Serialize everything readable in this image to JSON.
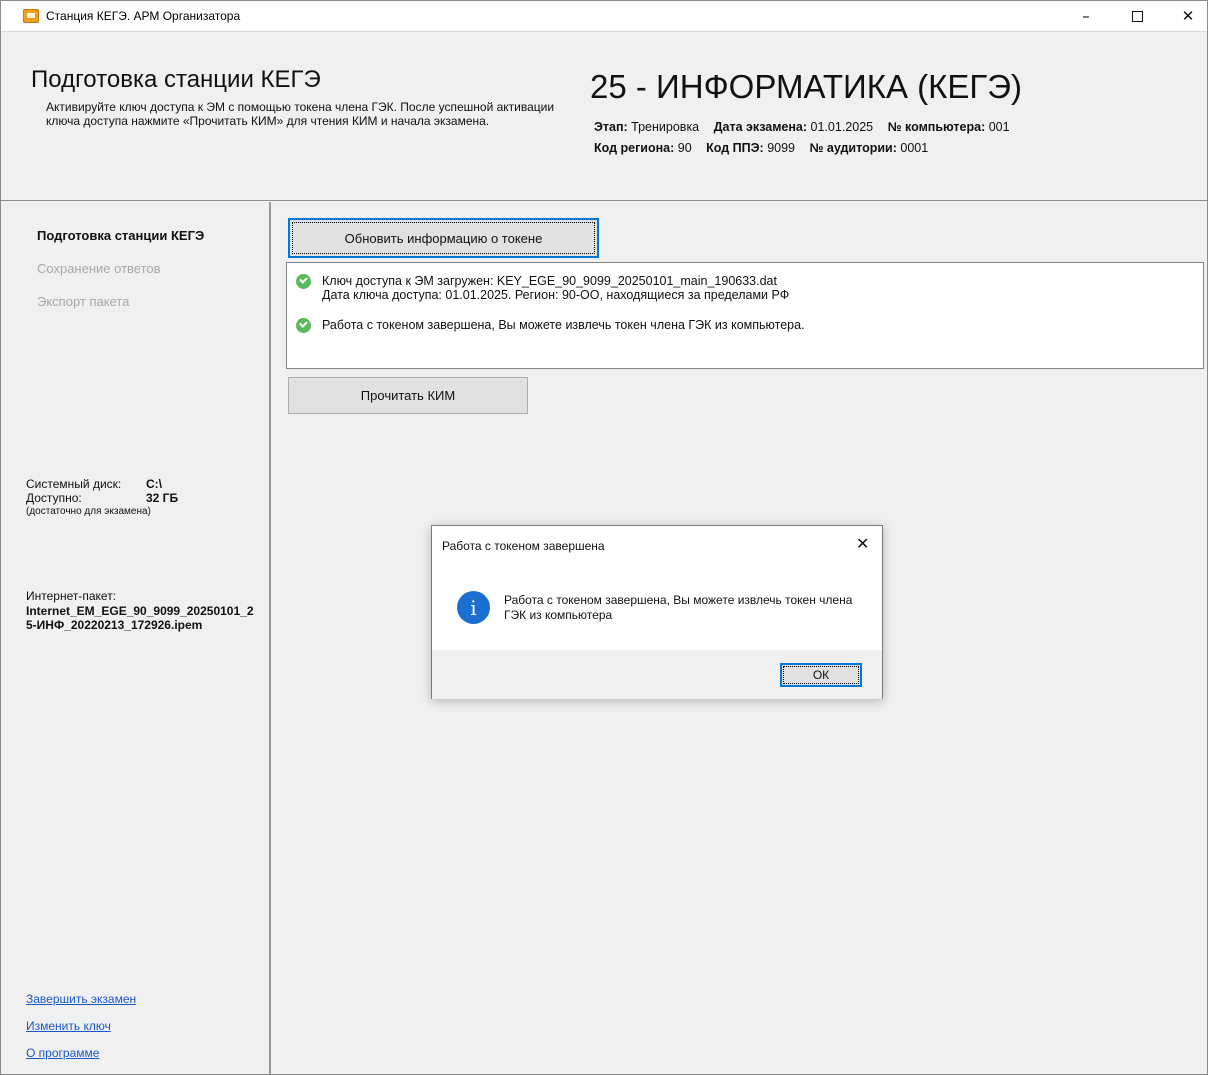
{
  "window": {
    "title": "Станция КЕГЭ. АРМ Организатора",
    "controls": {
      "minimize": "–",
      "maximize": "",
      "close": "✕"
    }
  },
  "header": {
    "title": "Подготовка станции КЕГЭ",
    "description": "Активируйте ключ доступа к ЭМ с помощью токена члена ГЭК. После успешной активации ключа доступа нажмите «Прочитать КИМ» для чтения КИМ и начала экзамена.",
    "subject": "25 - ИНФОРМАТИКА (КЕГЭ)",
    "stage_label": "Этап:",
    "stage_value": "Тренировка",
    "date_label": "Дата экзамена:",
    "date_value": "01.01.2025",
    "computer_label": "№ компьютера:",
    "computer_value": "001",
    "region_label": "Код региона:",
    "region_value": "90",
    "ppe_label": "Код ППЭ:",
    "ppe_value": "9099",
    "room_label": "№ аудитории:",
    "room_value": "0001"
  },
  "sidebar": {
    "items": [
      {
        "label": "Подготовка станции КЕГЭ",
        "state": "active"
      },
      {
        "label": "Сохранение ответов",
        "state": "disabled"
      },
      {
        "label": "Экспорт пакета",
        "state": "disabled"
      }
    ],
    "disk": {
      "system_label": "Системный диск:",
      "system_value": "C:\\",
      "free_label": "Доступно:",
      "free_value": "32 ГБ",
      "hint": "(достаточно для экзамена)"
    },
    "package": {
      "label": "Интернет-пакет:",
      "name": "Internet_EM_EGE_90_9099_20250101_25-ИНФ_20220213_172926.ipem"
    },
    "links": [
      "Завершить экзамен",
      "Изменить ключ",
      "О программе"
    ]
  },
  "main": {
    "refresh_button": "Обновить информацию о токене",
    "log": [
      {
        "icon": "check-circle-icon",
        "line1": "Ключ доступа к ЭМ загружен: KEY_EGE_90_9099_20250101_main_190633.dat",
        "line2": "Дата ключа доступа: 01.01.2025. Регион: 90-ОО, находящиеся за пределами РФ"
      },
      {
        "icon": "check-circle-icon",
        "line1": "Работа с токеном завершена, Вы можете извлечь токен члена ГЭК из компьютера."
      }
    ],
    "read_kim_button": "Прочитать КИМ"
  },
  "dialog": {
    "title": "Работа с токеном завершена",
    "close": "✕",
    "icon": "info-icon",
    "icon_glyph": "i",
    "message": "Работа с токеном завершена, Вы можете извлечь токен члена ГЭК из компьютера",
    "ok_button": "ОК"
  },
  "colors": {
    "accent": "#0078d7",
    "link": "#1a56c8",
    "success": "#5cb85c",
    "info": "#1a6fd0",
    "disabled_text": "#a8a8a8"
  }
}
